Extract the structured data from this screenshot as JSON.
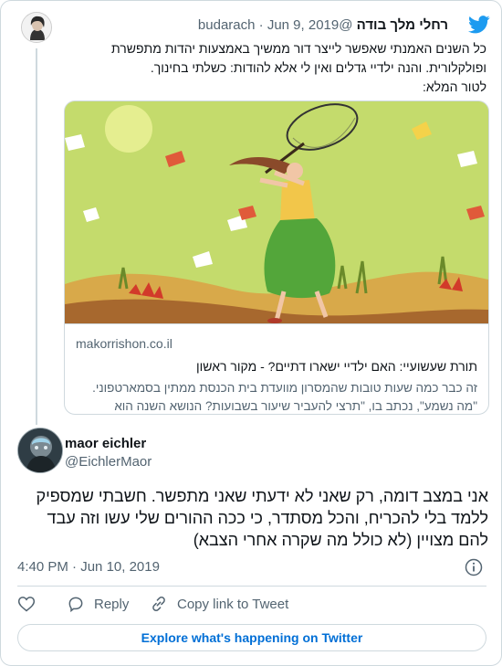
{
  "parent": {
    "name": "רחלי מלך בודה",
    "handle": "@budarach",
    "separator": "·",
    "date": "Jun 9, 2019",
    "text_lines": [
      "כל השנים האמנתי שאפשר לייצר דור ממשיך באמצעות יהדות מתפשרת",
      "ופולקלורית. והנה ילדיי גדלים ואין לי אלא להודות: כשלתי בחינוך.",
      "לטור המלא:"
    ],
    "link_card": {
      "domain": "makorrishon.co.il",
      "title": "תורת שעשועיי: האם ילדיי ישארו דתיים? - מקור ראשון",
      "description_lines": [
        "זה כבר כמה שעות טובות שהמסרון מוועדת בית הכנסת ממתין בסמארטפוני.",
        "\"מה נשמע\", נכתב בו, \"תרצי להעביר שיעור בשבועות? הנושא השנה הוא"
      ]
    }
  },
  "tweet": {
    "name": "maor eichler",
    "handle": "@EichlerMaor",
    "text_lines": [
      "אני במצב דומה, רק שאני לא ידעתי שאני מתפשר. חשבתי שמספיק",
      "ללמד בלי להכריח, והכל מסתדר, כי ככה ההורים שלי עשו וזה עבד",
      "להם מצויין (לא כולל מה שקרה אחרי הצבא)"
    ],
    "time": "4:40 PM",
    "separator": "·",
    "date": "Jun 10, 2019"
  },
  "actions": {
    "reply": "Reply",
    "copy_link": "Copy link to Tweet"
  },
  "explore_label": "Explore what's happening on Twitter",
  "colors": {
    "twitter_blue": "#1d9bf0",
    "link_blue": "#006fd6",
    "muted_text": "#536471",
    "border": "#cfd9de"
  },
  "icons": [
    "twitter-bird-icon",
    "info-icon",
    "heart-icon",
    "reply-bubble-icon",
    "link-icon"
  ]
}
